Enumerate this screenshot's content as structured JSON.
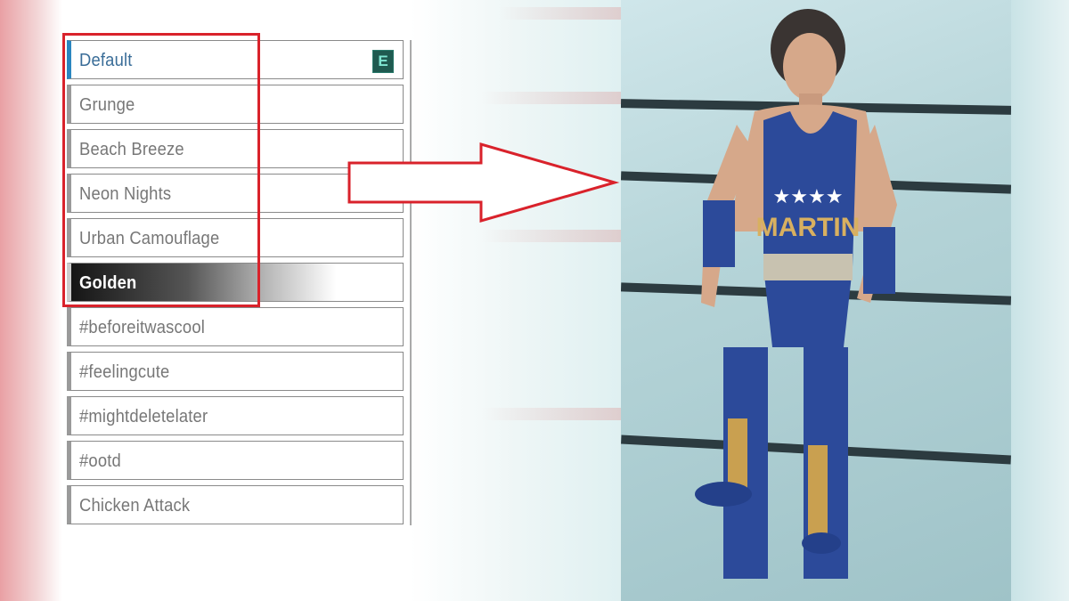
{
  "attires": {
    "items": [
      {
        "label": "Default",
        "badge": "E",
        "state": "equipped"
      },
      {
        "label": "Grunge"
      },
      {
        "label": "Beach Breeze"
      },
      {
        "label": "Neon Nights"
      },
      {
        "label": "Urban Camouflage"
      },
      {
        "label": "Golden",
        "state": "selected"
      },
      {
        "label": "#beforeitwascool"
      },
      {
        "label": "#feelingcute"
      },
      {
        "label": "#mightdeletelater"
      },
      {
        "label": "#ootd"
      },
      {
        "label": "Chicken Attack"
      }
    ]
  },
  "preview": {
    "singlet_text": "MARTIN"
  },
  "colors": {
    "highlight": "#d9222b",
    "equipped_accent": "#2a86c0",
    "badge": "#1f5a50"
  }
}
